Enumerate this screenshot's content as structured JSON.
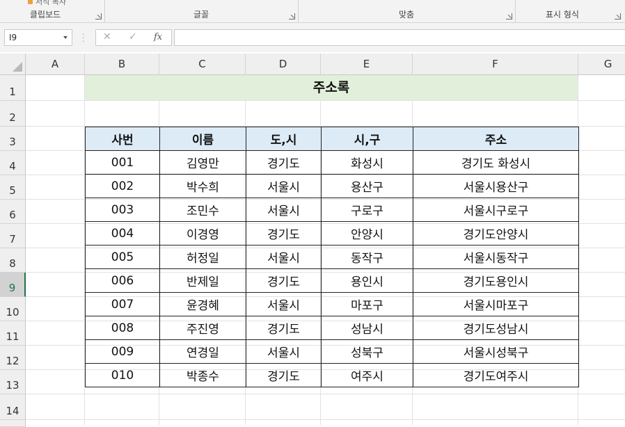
{
  "ribbon": {
    "partial_label": "서식 복사",
    "groups": [
      {
        "label": "클립보드"
      },
      {
        "label": "글꼴"
      },
      {
        "label": "맞춤"
      },
      {
        "label": "표시 형식"
      }
    ]
  },
  "formula_bar": {
    "name_box": "I9",
    "cancel_icon": "✕",
    "enter_icon": "✓",
    "fx_label": "fx",
    "formula": ""
  },
  "columns": [
    "A",
    "B",
    "C",
    "D",
    "E",
    "F",
    "G"
  ],
  "rows": [
    "1",
    "2",
    "3",
    "4",
    "5",
    "6",
    "7",
    "8",
    "9",
    "10",
    "11",
    "12",
    "13",
    "14"
  ],
  "selected_row": "9",
  "sheet": {
    "title": "주소록",
    "headers": [
      "사번",
      "이름",
      "도,시",
      "시,구",
      "주소"
    ],
    "records": [
      [
        "001",
        "김영만",
        "경기도",
        "화성시",
        "경기도 화성시"
      ],
      [
        "002",
        "박수희",
        "서울시",
        "용산구",
        "서울시용산구"
      ],
      [
        "003",
        "조민수",
        "서울시",
        "구로구",
        "서울시구로구"
      ],
      [
        "004",
        "이경영",
        "경기도",
        "안양시",
        "경기도안양시"
      ],
      [
        "005",
        "허정일",
        "서울시",
        "동작구",
        "서울시동작구"
      ],
      [
        "006",
        "반제일",
        "경기도",
        "용인시",
        "경기도용인시"
      ],
      [
        "007",
        "윤경혜",
        "서울시",
        "마포구",
        "서울시마포구"
      ],
      [
        "008",
        "주진영",
        "경기도",
        "성남시",
        "경기도성남시"
      ],
      [
        "009",
        "연경일",
        "서울시",
        "성북구",
        "서울시성북구"
      ],
      [
        "010",
        "박종수",
        "경기도",
        "여주시",
        "경기도여주시"
      ]
    ]
  },
  "colors": {
    "title_fill": "#e2efda",
    "header_fill": "#ddebf7",
    "selection_accent": "#217346"
  }
}
